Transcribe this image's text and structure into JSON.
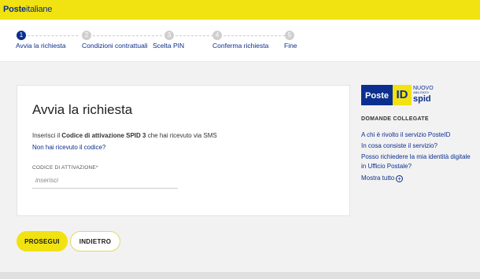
{
  "header": {
    "logo_bold": "Poste",
    "logo_regular": "italiane",
    "bar_color": "#f1e211"
  },
  "steps": [
    {
      "num": "1",
      "label": "Avvia la richiesta",
      "active": true
    },
    {
      "num": "2",
      "label": "Condizioni contrattuali",
      "active": false
    },
    {
      "num": "3",
      "label": "Scelta PIN",
      "active": false
    },
    {
      "num": "4",
      "label": "Conferma richiesta",
      "active": false
    },
    {
      "num": "5",
      "label": "Fine",
      "active": false
    }
  ],
  "main": {
    "title": "Avvia la richiesta",
    "instruction_pre": "Inserisci il ",
    "instruction_bold": "Codice di attivazione SPID 3",
    "instruction_post": " che hai ricevuto via SMS",
    "resend_link": "Non hai ricevuto il codice?",
    "field_label": "CODICE DI ATTIVAZIONE*",
    "field_placeholder": "inserisci",
    "field_value": ""
  },
  "actions": {
    "primary_label": "PROSEGUI",
    "secondary_label": "INDIETRO"
  },
  "sidebar": {
    "brand_poste": "Poste",
    "brand_id": "ID",
    "brand_nuovo": "NUOVO",
    "brand_abilitato": "ABILITATO",
    "brand_spid": "spid",
    "related_title": "DOMANDE COLLEGATE",
    "links": [
      "A chi è rivolto il servizio PosteID",
      "In cosa consiste il servizio?",
      "Posso richiedere la mia identità digitale in Ufficio Postale?"
    ],
    "more_label": "Mostra tutto",
    "more_icon": "plus-circle-icon"
  },
  "colors": {
    "accent_yellow": "#f1e211",
    "brand_blue": "#0b2f8f"
  }
}
